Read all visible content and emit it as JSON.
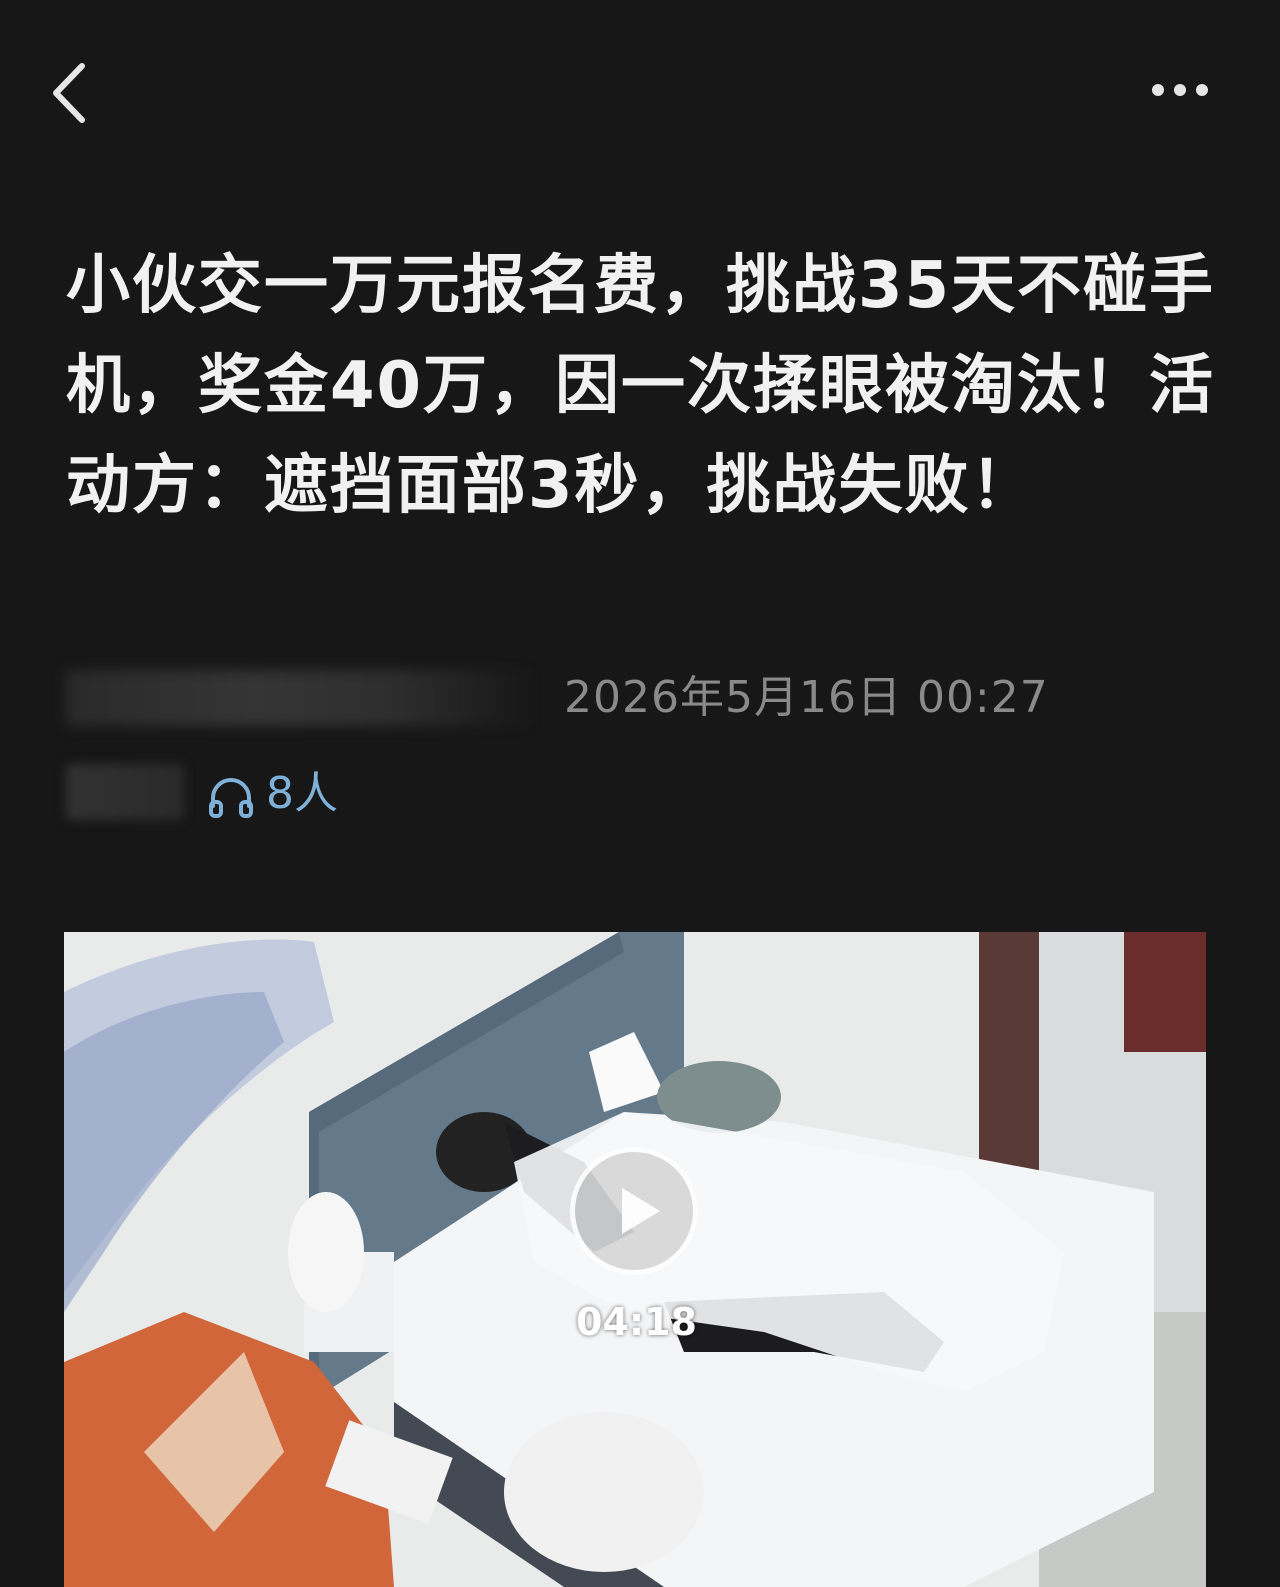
{
  "topbar": {
    "back_icon": "chevron-left-icon",
    "more_icon": "more-horizontal-icon"
  },
  "post": {
    "title": "小伙交一万元报名费，挑战35天不碰手机，奖金40万，因一次揉眼被淘汰！活动方：遮挡面部3秒，挑战失败！",
    "timestamp": "2026年5月16日 00:27",
    "listeners": "8人",
    "listen_icon": "headphones-icon"
  },
  "video": {
    "duration": "04:18",
    "play_icon": "play-icon"
  },
  "colors": {
    "background": "#171717",
    "title_text": "#f1f1f1",
    "meta_text": "#8a8a8a",
    "accent_blue": "#7fb0d8"
  }
}
